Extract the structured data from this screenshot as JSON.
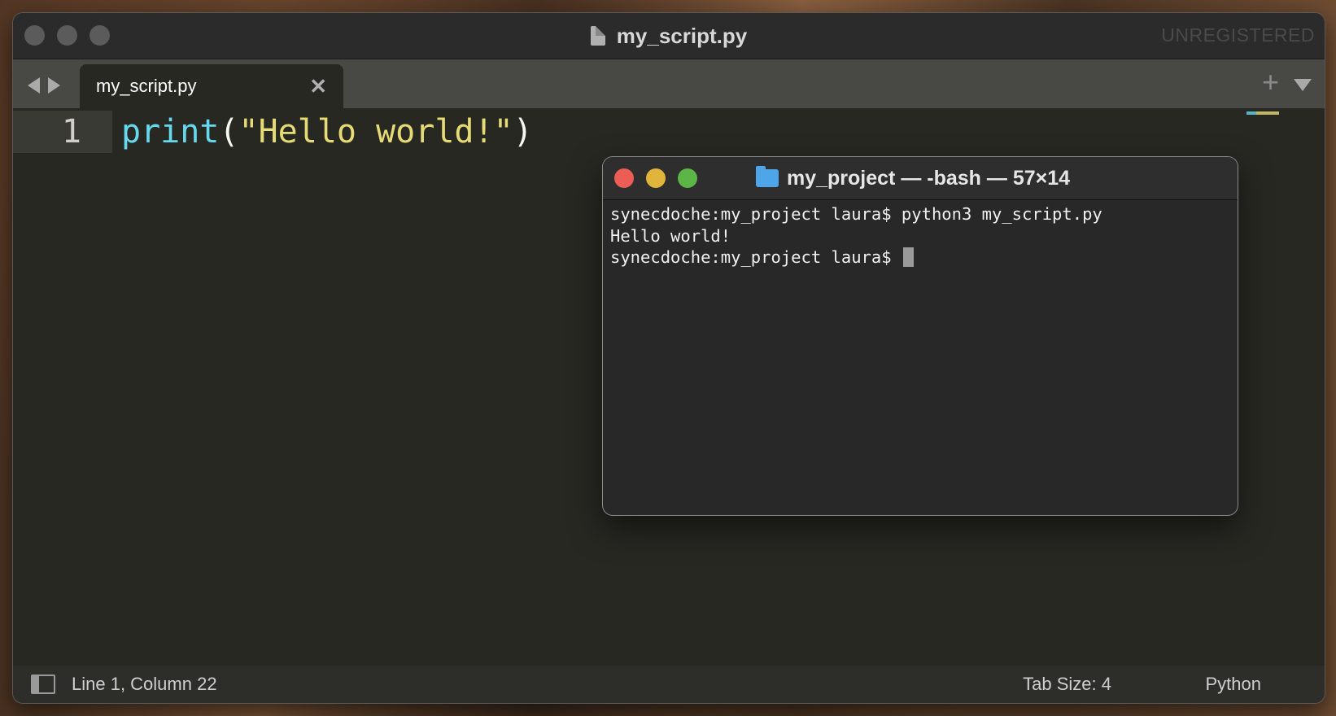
{
  "editor": {
    "window_title": "my_script.py",
    "unregistered_label": "UNREGISTERED",
    "tabs": [
      {
        "label": "my_script.py",
        "close_glyph": "✕"
      }
    ],
    "add_tab_glyph": "+",
    "line_numbers": [
      "1"
    ],
    "code": {
      "builtin": "print",
      "open_paren": "(",
      "string": "\"Hello world!\"",
      "close_paren": ")"
    },
    "status": {
      "position": "Line 1, Column 22",
      "tab_size": "Tab Size: 4",
      "syntax": "Python"
    }
  },
  "terminal": {
    "title": "my_project — -bash — 57×14",
    "lines": [
      "synecdoche:my_project laura$ python3 my_script.py",
      "Hello world!",
      "synecdoche:my_project laura$ "
    ]
  },
  "colors": {
    "editor_bg": "#272822",
    "keyword_builtin": "#66d9ef",
    "string": "#e6db74",
    "close_red": "#ec5e55",
    "minimize_yellow": "#e1b53b",
    "zoom_green": "#5cb547"
  },
  "icons": {
    "title_file": "python-file-icon",
    "terminal_folder": "folder-icon",
    "status_sidebar": "sidebar-toggle-icon"
  }
}
